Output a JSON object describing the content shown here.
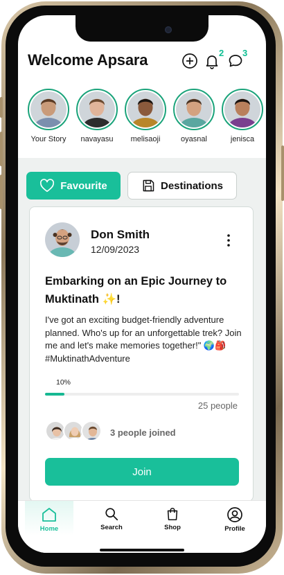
{
  "header": {
    "title": "Welcome Apsara",
    "notifications_count": "2",
    "messages_count": "3"
  },
  "stories": [
    {
      "name": "Your Story",
      "skin": "#c99b7a",
      "hair": "#5a3a24",
      "shirt": "#7b8fae"
    },
    {
      "name": "navayasu",
      "skin": "#e0b49a",
      "hair": "#6b4a30",
      "shirt": "#2d2d2d"
    },
    {
      "name": "melisaoji",
      "skin": "#8a5a3c",
      "hair": "#1a1410",
      "shirt": "#b8862a"
    },
    {
      "name": "oyasnal",
      "skin": "#d4a280",
      "hair": "#4a3322",
      "shirt": "#5aa7a0"
    },
    {
      "name": "jenisca",
      "skin": "#b9805c",
      "hair": "#1c1410",
      "shirt": "#7a3f8f"
    }
  ],
  "tabs": {
    "favourite": "Favourite",
    "destinations": "Destinations"
  },
  "post": {
    "author": "Don Smith",
    "date": "12/09/2023",
    "title": "Embarking on an Epic Journey to Muktinath ✨!",
    "body": "I've got an exciting budget-friendly adventure planned. Who's up for an unforgettable trek? Join me and let's make memories together!\" 🌍🎒 #MuktinathAdventure",
    "progress_label": "10%",
    "progress": 0.1,
    "capacity": "25 people",
    "joined_text": "3 people joined",
    "join_label": "Join"
  },
  "nav": {
    "home": "Home",
    "search": "Search",
    "shop": "Shop",
    "profile": "Profile"
  },
  "colors": {
    "accent": "#19bf9a",
    "badge": "#0fbf93"
  }
}
